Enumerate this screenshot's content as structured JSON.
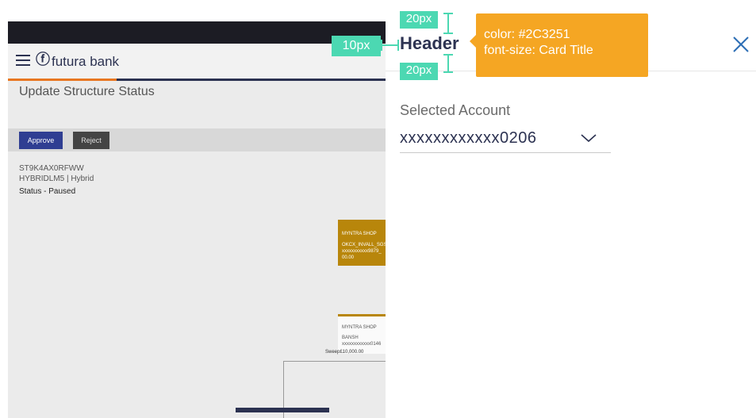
{
  "background_app": {
    "brand": "futura bank",
    "page_title": "Update Structure Status",
    "buttons": {
      "approve": "Approve",
      "reject": "Reject"
    },
    "structure_id": "ST9K4AX0RFWW",
    "structure_type_line": "HYBRIDLM5 | Hybrid",
    "status": "Status - Paused",
    "nodes": [
      {
        "title": "MYNTRA SHOP",
        "line1": "OKCX_INVALL_SGS",
        "line2": "xxxxxxxxxxx9879_",
        "line3": "00.00"
      },
      {
        "title": "MYNTRA SHOP",
        "line1": "BANSH",
        "line2": "xxxxxxxxxxxx0146"
      }
    ],
    "sweep_label": "Sweep£10,000.00",
    "colors": {
      "primary": "#2C3251",
      "accent": "#E87722",
      "node": "#B8860B"
    }
  },
  "panel": {
    "header": "Header",
    "close_icon": "close-icon",
    "selected_account_label": "Selected Account",
    "selected_account_value": "xxxxxxxxxxxx0206",
    "chevron_icon": "chevron-down-icon"
  },
  "annotations": {
    "top_spacing": "20px",
    "left_spacing": "10px",
    "bottom_spacing": "20px",
    "tooltip_line1": "color: #2C3251",
    "tooltip_line2": "font-size: Card Title",
    "tooltip_color": "#F5A623",
    "spacing_color": "#4CD8B2"
  }
}
